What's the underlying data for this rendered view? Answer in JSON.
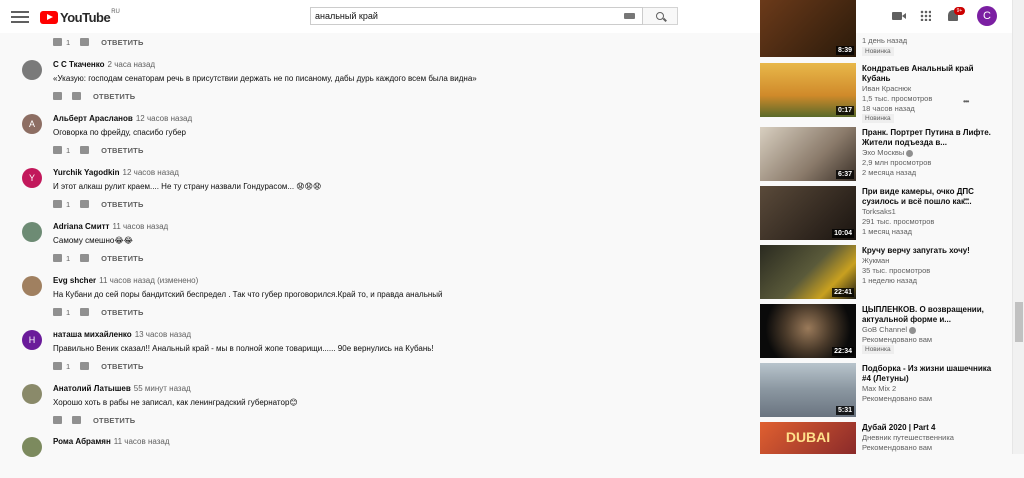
{
  "header": {
    "logo_text": "YouTube",
    "logo_region": "RU",
    "search_value": "анальный край",
    "notifications_badge": "9+",
    "user_initial": "C"
  },
  "comments": [
    {
      "author": "",
      "time": "",
      "text": "",
      "likes": "1",
      "reply": "ОТВЕТИТЬ",
      "partial": true
    },
    {
      "author": "С С Ткаченко",
      "time": "2 часа назад",
      "text": "«Указую: господам сенаторам речь в присутствии держать не по писаному, дабы дурь каждого всем была видна»",
      "likes": "",
      "reply": "ОТВЕТИТЬ",
      "avatar_color": "#7a7a7a"
    },
    {
      "author": "Альберт Арасланов",
      "time": "12 часов назад",
      "text": "Оговорка по фрейду, спасибо губер",
      "likes": "1",
      "reply": "ОТВЕТИТЬ",
      "avatar_initial": "A",
      "avatar_color": "#8d6e63"
    },
    {
      "author": "Yurchik Yagodkin",
      "time": "12 часов назад",
      "text": "И этот алкаш рулит краем.... Не ту страну назвали Гондурасом... 😧😧😧",
      "likes": "1",
      "reply": "ОТВЕТИТЬ",
      "avatar_initial": "Y",
      "avatar_color": "#c2185b"
    },
    {
      "author": "Adriana Смитт",
      "time": "11 часов назад",
      "text": "Самому смешно😂😂",
      "likes": "1",
      "reply": "ОТВЕТИТЬ",
      "avatar_color": "#6d8b74"
    },
    {
      "author": "Evg shcher",
      "time": "11 часов назад (изменено)",
      "text": "На Кубани  до сей поры бандитский беспредел . Так что губер проговорился.Край то, и правда анальный",
      "likes": "1",
      "reply": "ОТВЕТИТЬ",
      "avatar_color": "#a08060"
    },
    {
      "author": "наташа михайленко",
      "time": "13 часов назад",
      "text": "Правильно Веник сказал!! Анальный край - мы в полной жопе товарищи...... 90е вернулись на Кубань!",
      "likes": "1",
      "reply": "ОТВЕТИТЬ",
      "avatar_initial": "H",
      "avatar_color": "#6a1b9a"
    },
    {
      "author": "Анатолий Латышев",
      "time": "55 минут назад",
      "text": "Хорошо хоть в рабы не записал, как ленинградский губернатор😊",
      "likes": "",
      "reply": "ОТВЕТИТЬ",
      "avatar_color": "#8a8a6a"
    },
    {
      "author": "Рома Абрамян",
      "time": "11 часов назад",
      "text": "",
      "likes": "",
      "reply": "",
      "avatar_color": "#7c8a5e"
    }
  ],
  "sidebar": [
    {
      "title": "",
      "channel": "",
      "meta1": "",
      "meta2": "1 день назад",
      "badge": "Новинка",
      "duration": "8:39",
      "thumb_color": "#8a5a2a",
      "partial": true,
      "meta_top": ""
    },
    {
      "title": "Кондратьев Анальный край Кубань",
      "channel": "Иван Краснюк",
      "meta1": "1,5 тыс. просмотров",
      "meta2": "18 часов назад",
      "badge": "Новинка",
      "duration": "0:17",
      "thumb_color": "#d9a63a"
    },
    {
      "title": "Пранк. Портрет Путина в Лифте. Жители подъезда в...",
      "channel": "Эхо Москвы",
      "verified": true,
      "meta1": "2,9 млн просмотров",
      "meta2": "2 месяца назад",
      "duration": "6:37",
      "thumb_color": "#b8a890"
    },
    {
      "title": "При виде камеры, очко ДПС сузилось и всё пошло как...",
      "channel": "Torksaks1",
      "meta1": "291 тыс. просмотров",
      "meta2": "1 месяц назад",
      "duration": "10:04",
      "thumb_color": "#4a3a2a"
    },
    {
      "title": "Кручу верчу запугать хочу!",
      "channel": "Жукман",
      "meta1": "35 тыс. просмотров",
      "meta2": "1 неделю назад",
      "duration": "22:41",
      "thumb_color": "#3a3a2a"
    },
    {
      "title": "ЦЫПЛЕНКОВ. О возвращении, актуальной форме и...",
      "channel": "GoB Channel",
      "verified": true,
      "meta1": "Рекомендовано вам",
      "meta2": "",
      "badge": "Новинка",
      "duration": "22:34",
      "thumb_color": "#2a2a2a"
    },
    {
      "title": "Подборка - Из жизни шашечника #4 (Летуны)",
      "channel": "Max Mix 2",
      "meta1": "Рекомендовано вам",
      "meta2": "",
      "duration": "5:31",
      "thumb_color": "#7a8a9a"
    },
    {
      "title": "Дубай 2020 | Part 4",
      "channel": "Дневник путешественника",
      "meta1": "Рекомендовано вам",
      "meta2": "",
      "duration": "",
      "thumb_color": "#c05030",
      "thumb_text": "DUBAI"
    }
  ]
}
